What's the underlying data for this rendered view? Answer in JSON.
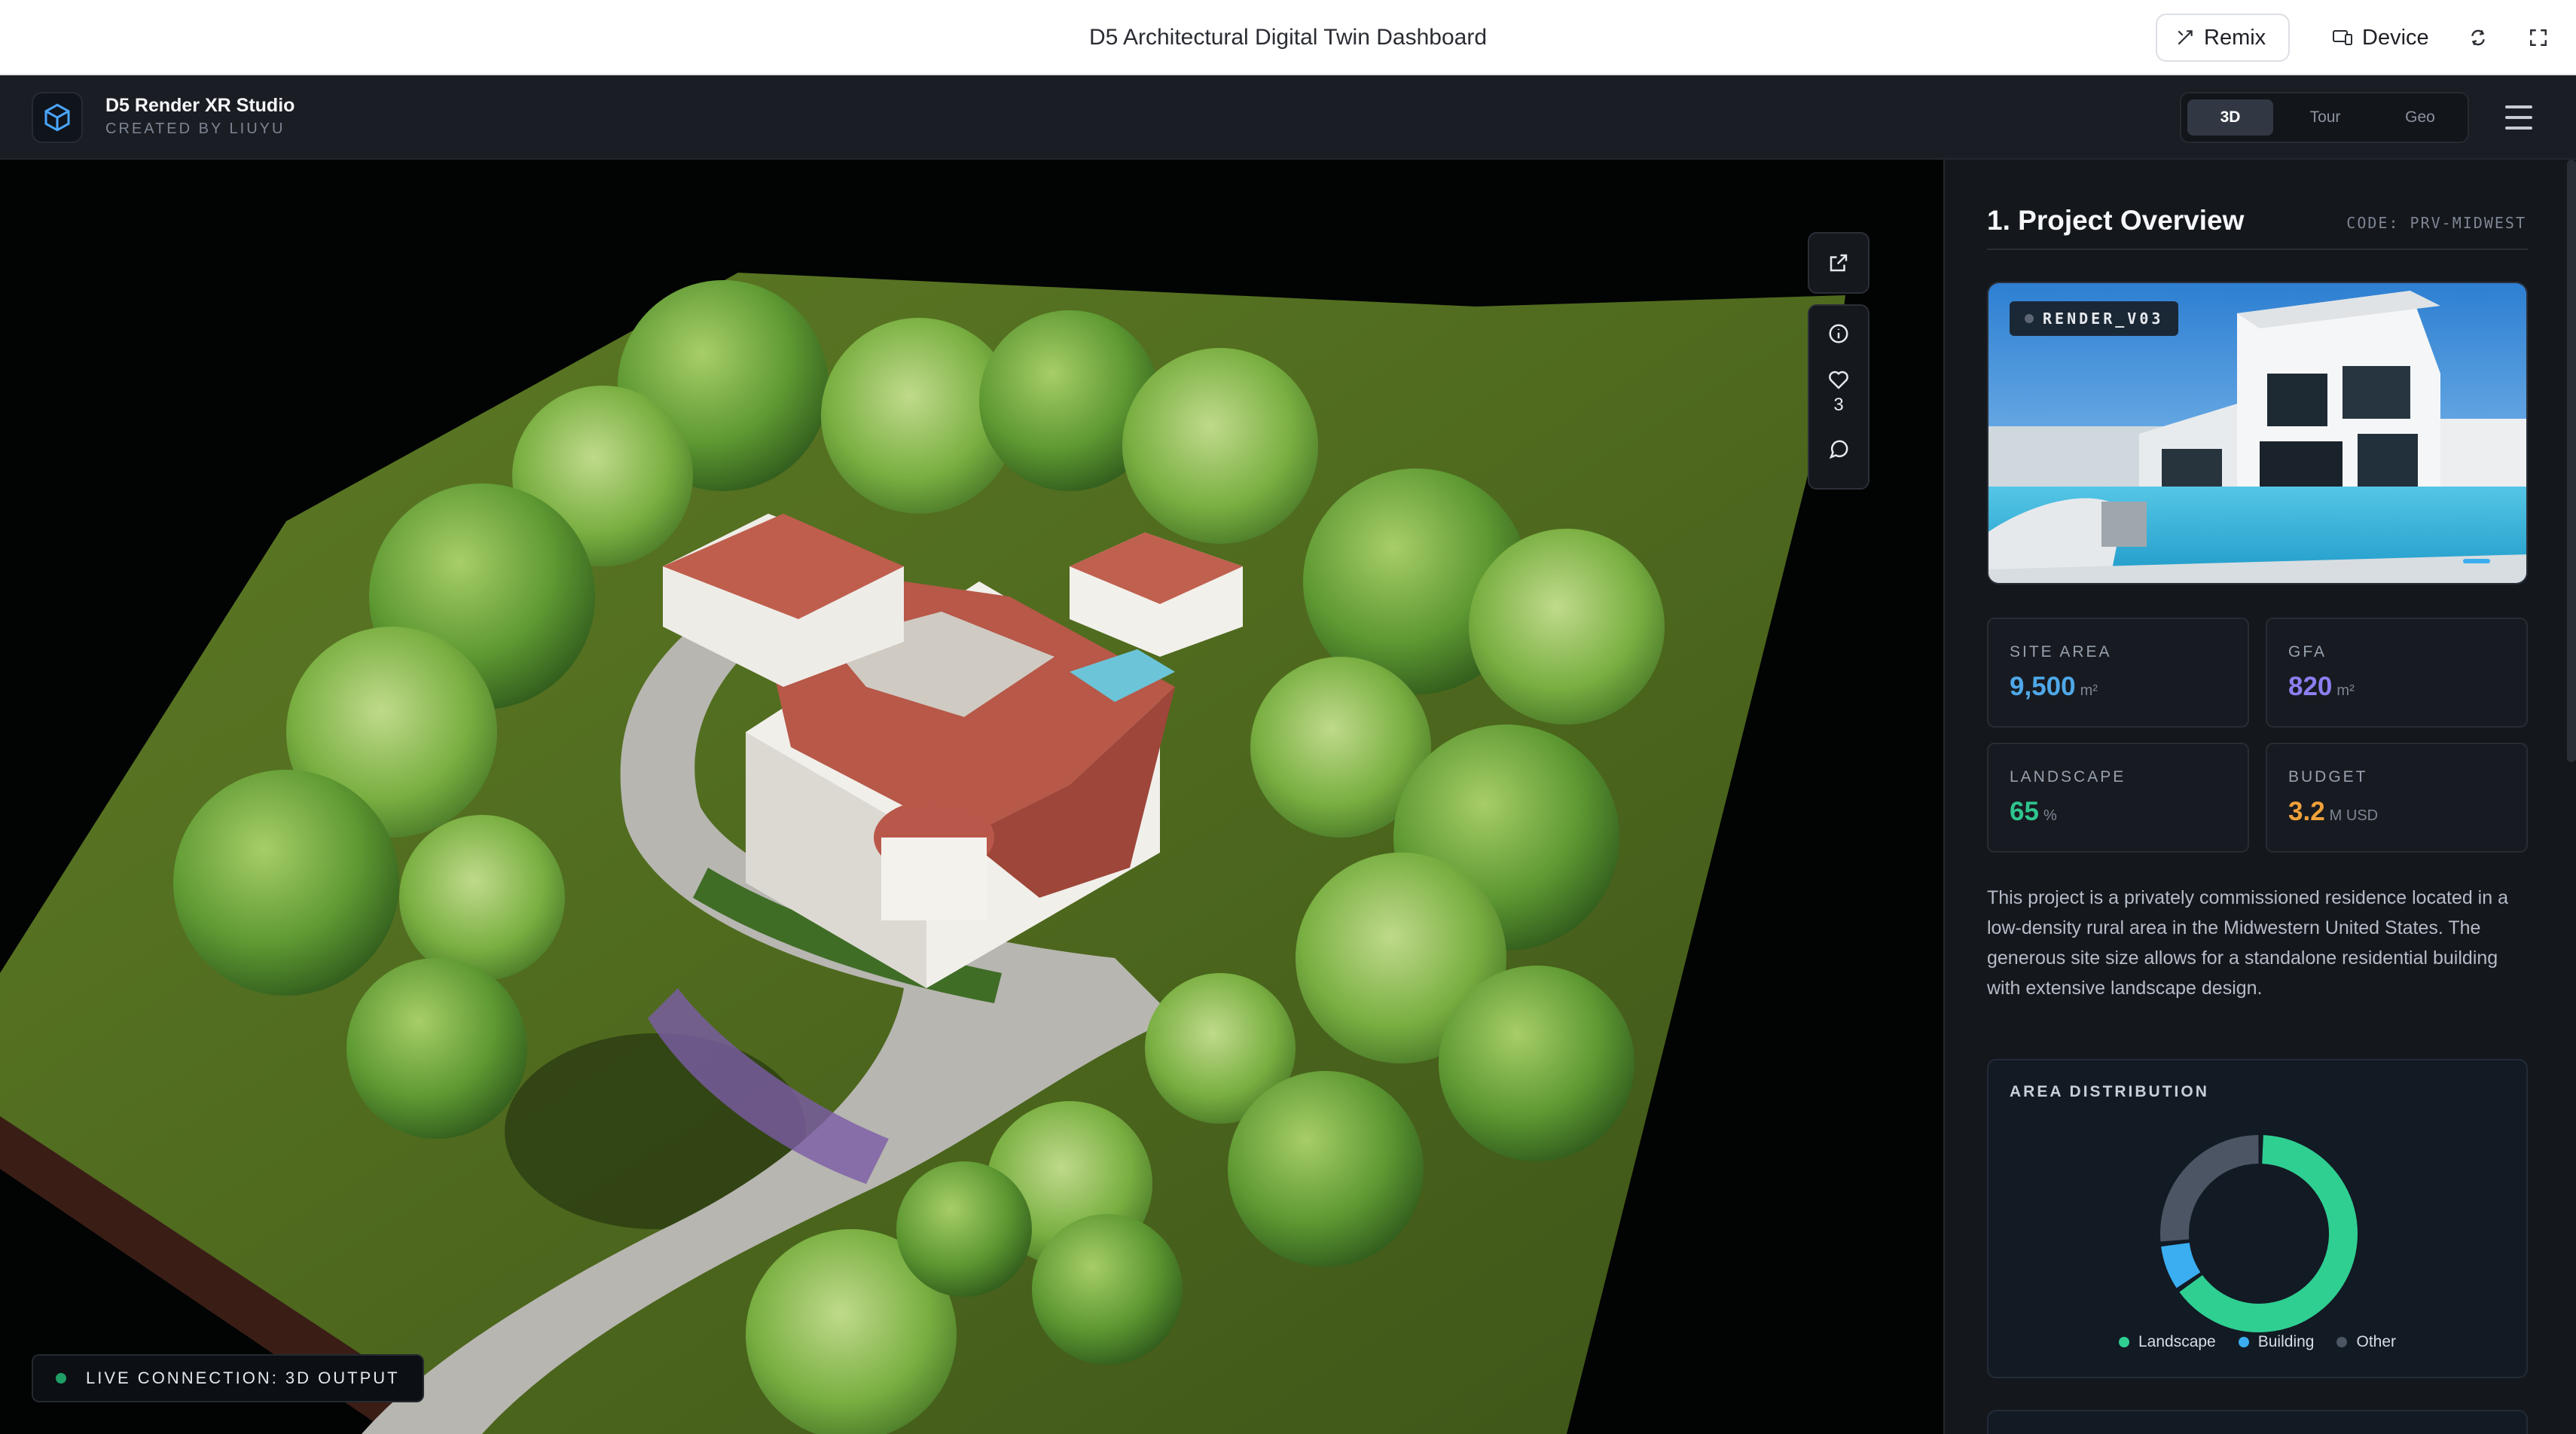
{
  "topbar": {
    "title": "D5 Architectural Digital Twin Dashboard",
    "remix_label": "Remix",
    "device_label": "Device"
  },
  "header": {
    "brand_name": "D5 Render XR Studio",
    "brand_sub": "CREATED BY LIUYU",
    "view_modes": [
      "3D",
      "Tour",
      "Geo"
    ],
    "active_mode": "3D"
  },
  "viewport": {
    "likes": "3",
    "live_status": "LIVE CONNECTION: 3D OUTPUT"
  },
  "panel": {
    "title": "1. Project Overview",
    "code": "CODE: PRV-MIDWEST",
    "render_badge": "RENDER_V03",
    "stats": [
      {
        "label": "SITE AREA",
        "value": "9,500",
        "unit": "m²",
        "color": "#4fa8e8"
      },
      {
        "label": "GFA",
        "value": "820",
        "unit": "m²",
        "color": "#8b7ff0"
      },
      {
        "label": "LANDSCAPE",
        "value": "65",
        "unit": "%",
        "color": "#2fc48d"
      },
      {
        "label": "BUDGET",
        "value": "3.2",
        "unit": "M USD",
        "color": "#f0a03a"
      }
    ],
    "description": "This project is a privately commissioned residence located in a low-density rural area in the Midwestern United States. The generous site size allows for a standalone residential building with extensive landscape design.",
    "area_title": "AREA DISTRIBUTION",
    "legend": [
      {
        "label": "Landscape",
        "color": "#2fcf92"
      },
      {
        "label": "Building",
        "color": "#3aaef0"
      },
      {
        "label": "Other",
        "color": "#4b5564"
      }
    ]
  },
  "chart_data": {
    "type": "pie",
    "categories": [
      "Landscape",
      "Building",
      "Other"
    ],
    "values": [
      65,
      8,
      27
    ]
  }
}
